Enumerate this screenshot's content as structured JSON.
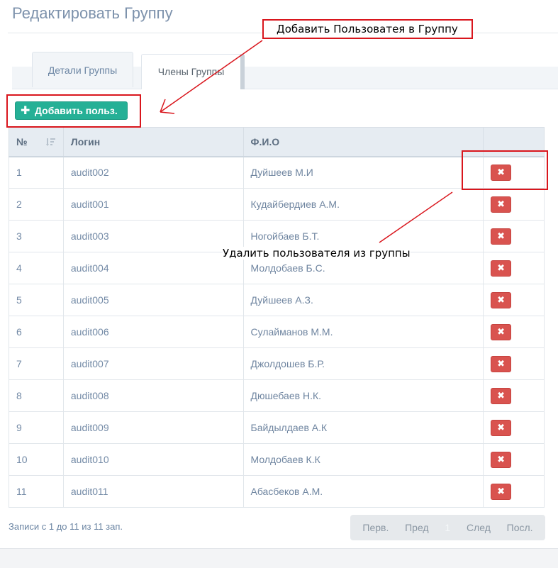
{
  "page": {
    "title": "Редактировать Группу"
  },
  "tabs": [
    {
      "label": "Детали Группы",
      "active": false
    },
    {
      "label": "Члены Группы",
      "active": true
    }
  ],
  "toolbar": {
    "add_label": "Добавить польз.",
    "add_icon": "plus-icon"
  },
  "table": {
    "columns": [
      "№",
      "Логин",
      "Ф.И.О",
      ""
    ],
    "rows": [
      {
        "num": "1",
        "login": "audit002",
        "fio": "Дуйшеев М.И"
      },
      {
        "num": "2",
        "login": "audit001",
        "fio": "Кудайбердиев А.М."
      },
      {
        "num": "3",
        "login": "audit003",
        "fio": "Ногойбаев Б.Т."
      },
      {
        "num": "4",
        "login": "audit004",
        "fio": "Молдобаев Б.С."
      },
      {
        "num": "5",
        "login": "audit005",
        "fio": "Дуйшеев А.З."
      },
      {
        "num": "6",
        "login": "audit006",
        "fio": "Сулайманов М.М."
      },
      {
        "num": "7",
        "login": "audit007",
        "fio": "Джолдошев Б.Р."
      },
      {
        "num": "8",
        "login": "audit008",
        "fio": "Дюшебаев Н.К."
      },
      {
        "num": "9",
        "login": "audit009",
        "fio": "Байдылдаев А.К"
      },
      {
        "num": "10",
        "login": "audit010",
        "fio": "Молдобаев К.К"
      },
      {
        "num": "11",
        "login": "audit011",
        "fio": "Абасбеков А.М."
      }
    ],
    "delete_icon": "remove-icon"
  },
  "footer": {
    "info": "Записи с 1 до 11 из 11 зап.",
    "pager": {
      "first": "Перв.",
      "prev": "Пред",
      "current": "1",
      "next": "След",
      "last": "Посл."
    }
  },
  "annotations": {
    "add_callout": "Добавить Пользоватея в Группу",
    "delete_callout": "Удалить пользователя из группы"
  },
  "colors": {
    "accent_green": "#25b096",
    "danger_red": "#d9534f",
    "annotation_red": "#d9161d"
  }
}
